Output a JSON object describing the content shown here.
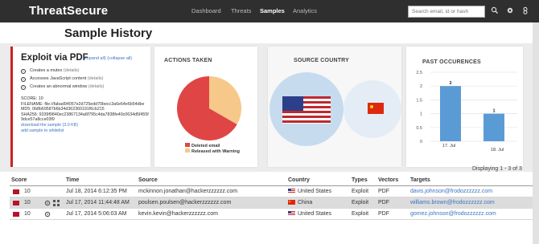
{
  "header": {
    "brand": "ThreatSecure",
    "nav": [
      "Dashboard",
      "Threats",
      "Samples",
      "Analytics"
    ],
    "active_nav": "Samples",
    "search_placeholder": "Search email, id or hash",
    "icons": [
      "search-icon",
      "gear-icon",
      "user-icon"
    ]
  },
  "page_title": "Sample History",
  "exploit": {
    "title": "Exploit via PDF",
    "expand_all": "(expand all)",
    "collapse_all": "(collapse all)",
    "behaviors": [
      {
        "text": "Creates a mutex",
        "details": "(details)"
      },
      {
        "text": "Accesses JavaScript content",
        "details": "(details)"
      },
      {
        "text": "Creates an abnormal window",
        "details": "(details)"
      }
    ],
    "score": "SCORE: 10",
    "filename": "FILENAME: file://fabad94057e2d725edd70becc3a6e64e6b54dbe",
    "md5": "MD5: 0b8b69587b6b34d362360191f6cb215",
    "sha256": "SHA256: 9339f9840ec23867134a6f795c4da7838fe40c0634d5f455f9dce57a8cce03f9",
    "download": "download the sample (3.0 KB)",
    "whitelist": "add sample to whitelist"
  },
  "actions_taken": {
    "title": "ACTIONS TAKEN",
    "legend": [
      {
        "label": "Deleted email",
        "color": "#e04545"
      },
      {
        "label": "Released with Warning",
        "color": "#f6c88a"
      }
    ]
  },
  "source_country": {
    "title": "SOURCE COUNTRY"
  },
  "past_occurrences": {
    "title": "PAST OCCURENCES"
  },
  "chart_data": [
    {
      "type": "pie",
      "title": "ACTIONS TAKEN",
      "categories": [
        "Deleted email",
        "Released with Warning"
      ],
      "values": [
        2,
        1
      ],
      "colors": [
        "#f6c88a",
        "#e04545"
      ]
    },
    {
      "type": "bar",
      "title": "PAST OCCURENCES",
      "categories": [
        "17. Jul",
        "18. Jul"
      ],
      "values": [
        2,
        1
      ],
      "yticks": [
        "2.5",
        "2",
        "1.5",
        "1",
        "0.5",
        "0"
      ],
      "ylim": [
        0,
        2.5
      ],
      "color": "#5b9bd5"
    }
  ],
  "table": {
    "displaying": "Displaying 1 - 3 of 3",
    "columns": [
      "Score",
      "Time",
      "Source",
      "Country",
      "Types",
      "Vectors",
      "Targets"
    ],
    "rows": [
      {
        "score": "10",
        "time": "Jul 18, 2014 6:12:35 PM",
        "source": "mckinnon.jonathan@hackerzzzzzz.com",
        "country": "United States",
        "type": "Exploit",
        "vector": "PDF",
        "target": "davis.johnson@frodozzzzzz.com"
      },
      {
        "score": "10",
        "time": "Jul 17, 2014 11:44:48 AM",
        "source": "poulsen.poulsen@hackerzzzzzz.com",
        "country": "China",
        "type": "Exploit",
        "vector": "PDF",
        "target": "williams.brown@frodozzzzzz.com"
      },
      {
        "score": "10",
        "time": "Jul 17, 2014 5:06:03 AM",
        "source": "kevin.kevin@hackerzzzzzz.com",
        "country": "United States",
        "type": "Exploit",
        "vector": "PDF",
        "target": "gomez.johnson@frodozzzzzz.com"
      }
    ]
  },
  "colors": {
    "topbar": "#2f2f2f",
    "severity": "#b3142c",
    "link": "#3b73c6",
    "accent_red": "#cc2222"
  }
}
